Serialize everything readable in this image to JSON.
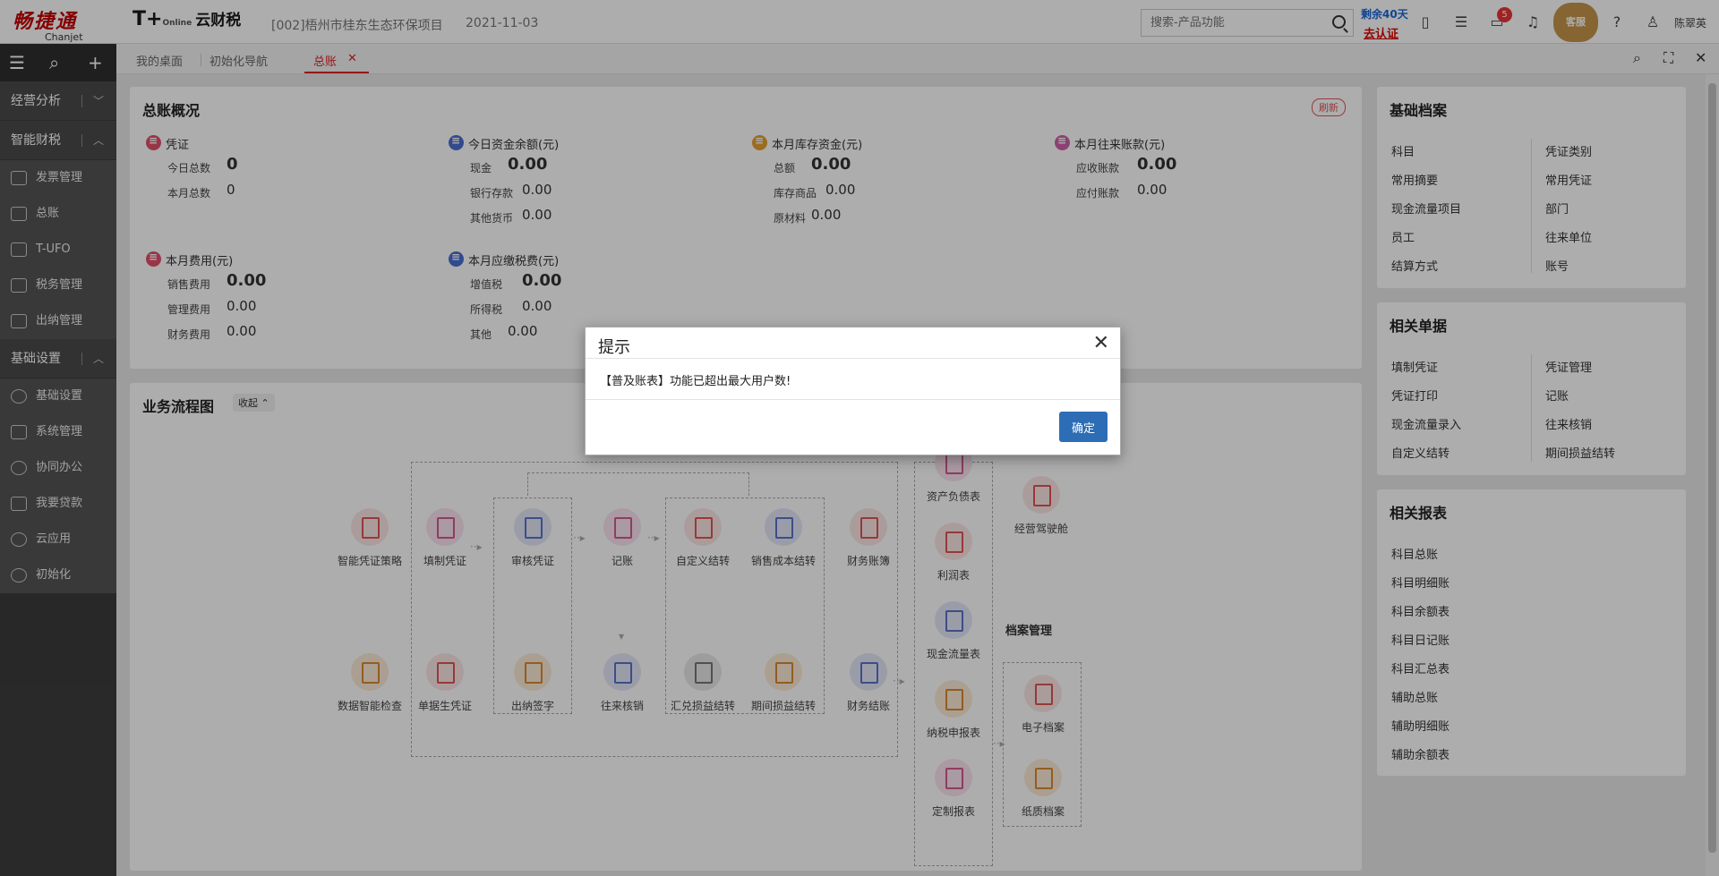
{
  "topbar": {
    "logo_cn": "畅捷通",
    "logo_en": "Chanjet",
    "product_t": "T+",
    "product_online": "Online",
    "product_name": "云财税",
    "ledger": "[002]梧州市桂东生态环保项目",
    "date": "2021-11-03",
    "search_placeholder": "搜索-产品功能",
    "remain": "剩余40天",
    "certify": "去认证",
    "notification_count": "5",
    "kefu": "客服",
    "username": "陈翠英"
  },
  "sidebar": {
    "groups": [
      {
        "label": "经营分析"
      },
      {
        "label": "智能财税",
        "items": [
          "发票管理",
          "总账",
          "T-UFO",
          "税务管理",
          "出纳管理"
        ]
      },
      {
        "label": "基础设置",
        "items": [
          "基础设置",
          "系统管理",
          "协同办公",
          "我要贷款",
          "云应用",
          "初始化"
        ]
      }
    ]
  },
  "tabs": {
    "t1": "我的桌面",
    "t2": "初始化导航",
    "t3": "总账",
    "close": "✕"
  },
  "overview": {
    "title": "总账概况",
    "refresh": "刷新",
    "voucher": {
      "head": "凭证",
      "r1_label": "今日总数",
      "r1_val": "0",
      "r2_label": "本月总数",
      "r2_val": "0"
    },
    "cash": {
      "head": "今日资金余额(元)",
      "r1_label": "现金",
      "r1_val": "0.00",
      "r2_label": "银行存款",
      "r2_val": "0.00",
      "r3_label": "其他货币",
      "r3_val": "0.00"
    },
    "stock": {
      "head": "本月库存资金(元)",
      "r1_label": "总额",
      "r1_val": "0.00",
      "r2_label": "库存商品",
      "r2_val": "0.00",
      "r3_label": "原材料",
      "r3_val": "0.00"
    },
    "ar": {
      "head": "本月往来账款(元)",
      "r1_label": "应收账款",
      "r1_val": "0.00",
      "r2_label": "应付账款",
      "r2_val": "0.00"
    },
    "expense": {
      "head": "本月费用(元)",
      "r1_label": "销售费用",
      "r1_val": "0.00",
      "r2_label": "管理费用",
      "r2_val": "0.00",
      "r3_label": "财务费用",
      "r3_val": "0.00"
    },
    "tax": {
      "head": "本月应缴税费(元)",
      "r1_label": "增值税",
      "r1_val": "0.00",
      "r2_label": "所得税",
      "r2_val": "0.00",
      "r3_label": "其他",
      "r3_val": "0.00"
    }
  },
  "flow": {
    "title": "业务流程图",
    "collapse": "收起",
    "archive_title": "档案管理",
    "items": {
      "ai_voucher": "智能凭证策略",
      "fill_voucher": "填制凭证",
      "audit_voucher": "审核凭证",
      "post": "记账",
      "custom_carry": "自定义结转",
      "sales_cost": "销售成本结转",
      "ledger_book": "财务账簿",
      "data_check": "数据智能检查",
      "doc_voucher": "单据生凭证",
      "cashier_sign": "出纳签字",
      "reconcile": "往来核销",
      "fx_carry": "汇兑损益结转",
      "pl_carry": "期间损益结转",
      "closing": "财务结账",
      "balance_sheet": "资产负债表",
      "income": "利润表",
      "cashflow": "现金流量表",
      "tax_return": "纳税申报表",
      "custom_report": "定制报表",
      "cockpit": "经营驾驶舱",
      "e_archive": "电子档案",
      "paper_archive": "纸质档案"
    }
  },
  "basic": {
    "title": "基础档案",
    "left": [
      "科目",
      "常用摘要",
      "现金流量项目",
      "员工",
      "结算方式"
    ],
    "right": [
      "凭证类别",
      "常用凭证",
      "部门",
      "往来单位",
      "账号"
    ]
  },
  "docs": {
    "title": "相关单据",
    "left": [
      "填制凭证",
      "凭证打印",
      "现金流量录入",
      "自定义结转"
    ],
    "right": [
      "凭证管理",
      "记账",
      "往来核销",
      "期间损益结转"
    ]
  },
  "reports": {
    "title": "相关报表",
    "items": [
      "科目总账",
      "科目明细账",
      "科目余额表",
      "科目日记账",
      "科目汇总表",
      "辅助总账",
      "辅助明细账",
      "辅助余额表"
    ]
  },
  "dialog": {
    "title": "提示",
    "close": "✕",
    "message": "【普及账表】功能已超出最大用户数!",
    "ok": "确定"
  },
  "colors": {
    "accent": "#d22222",
    "ok_button": "#2d6db5"
  }
}
